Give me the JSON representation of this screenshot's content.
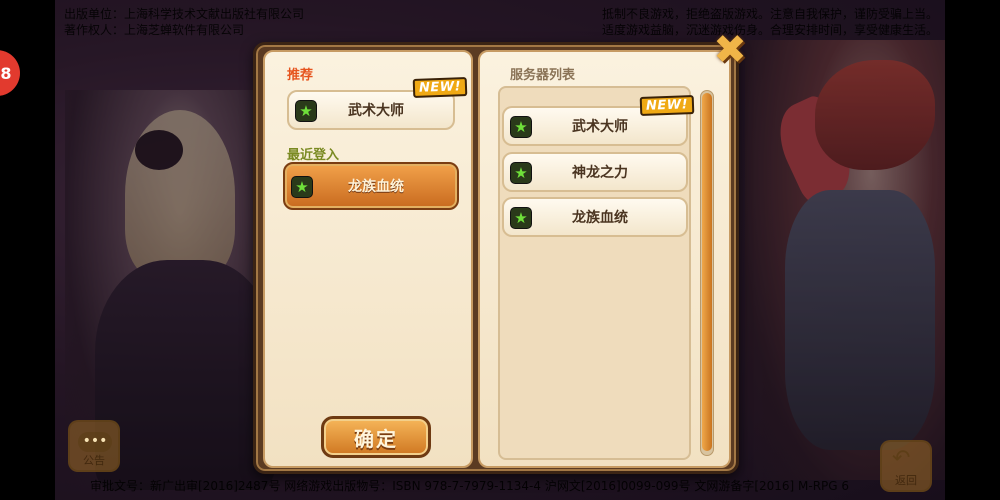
{
  "background": {
    "publisher_line": "出版单位：上海科学技术文献出版社有限公司",
    "copyright_line": "著作权人：上海芝蝉软件有限公司",
    "health_notice_1": "抵制不良游戏，拒绝盗版游戏。注意自我保护，谨防受骗上当。",
    "health_notice_2": "适度游戏益脑，沉迷游戏伤身。合理安排时间，享受健康生活。",
    "approval_line": "审批文号：新广出审[2016]2487号   网络游戏出版物号：ISBN 978-7-7979-1134-4   沪网文[2016]0099-099号   文网游备字[2016] M-RPG 6"
  },
  "side_badge": {
    "glyph": "8"
  },
  "corner_buttons": {
    "notice_label": "公告",
    "notice_dots": "•••",
    "back_label": "返回",
    "back_arrow": "↶"
  },
  "dialog": {
    "left_panel": {
      "recommend_heading": "推荐",
      "recommended_server": {
        "name": "武术大师",
        "badge": "NEW!"
      },
      "recent_heading": "最近登入",
      "recent_server": {
        "name": "龙族血统"
      },
      "confirm_label": "确定"
    },
    "right_panel": {
      "list_heading": "服务器列表",
      "servers": [
        {
          "name": "武术大师",
          "badge": "NEW!"
        },
        {
          "name": "神龙之力"
        },
        {
          "name": "龙族血统"
        }
      ]
    },
    "close_glyph": "✖"
  },
  "icons": {
    "server_status": "green-star-icon",
    "star_glyph": "★"
  },
  "colors": {
    "accent_orange": "#e6541e",
    "recent_green": "#7a8a22",
    "new_badge": "#f0a914",
    "selected_button": "#cf7721"
  }
}
